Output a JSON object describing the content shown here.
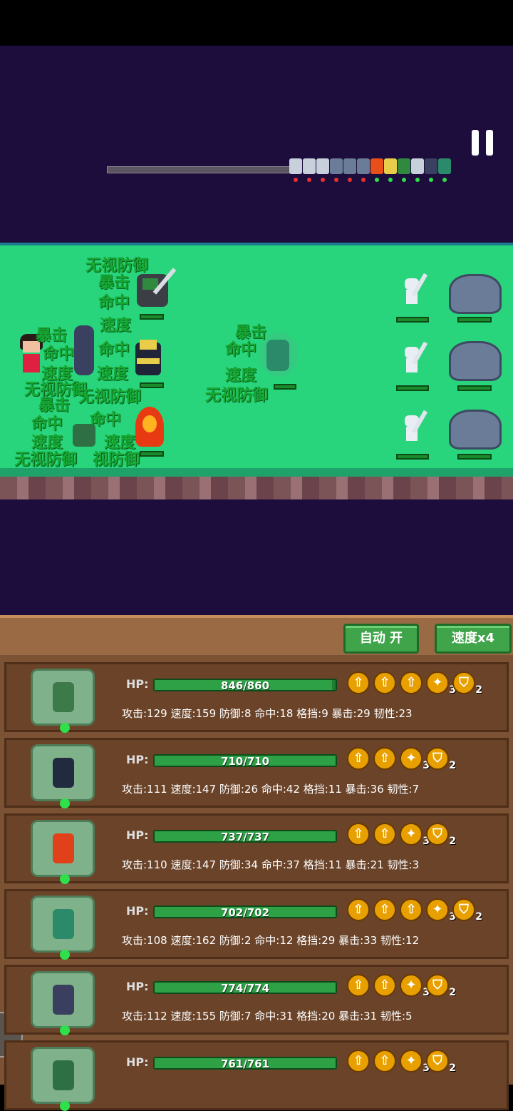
{
  "colors": {
    "sky": "#1c0d3c",
    "field": "#28d47c",
    "hp_green": "#1e7d33",
    "panel": "#7b5233",
    "buff_orange": "#e8a000",
    "damage_text": "#17a833"
  },
  "battle_queue": {
    "dots": [
      "red",
      "red",
      "red",
      "red",
      "red",
      "red",
      "green",
      "green",
      "green",
      "green",
      "green",
      "green"
    ]
  },
  "battlefield": {
    "floating_texts": [
      {
        "id": "t1",
        "text": "无视防御"
      },
      {
        "id": "t2",
        "text": "暴击"
      },
      {
        "id": "t3",
        "text": "命中"
      },
      {
        "id": "t4",
        "text": "速度"
      },
      {
        "id": "t5",
        "text": "暴击"
      },
      {
        "id": "t6",
        "text": "命中"
      },
      {
        "id": "t7",
        "text": "命中"
      },
      {
        "id": "t8",
        "text": "速度"
      },
      {
        "id": "t9",
        "text": "速度"
      },
      {
        "id": "t10",
        "text": "无视防御"
      },
      {
        "id": "t11",
        "text": "无视防御"
      },
      {
        "id": "t12",
        "text": "暴击"
      },
      {
        "id": "t13",
        "text": "命中"
      },
      {
        "id": "t14",
        "text": "命中"
      },
      {
        "id": "t15",
        "text": "速度"
      },
      {
        "id": "t16",
        "text": "速度"
      },
      {
        "id": "t17",
        "text": "无视防御"
      },
      {
        "id": "t18",
        "text": "视防御"
      },
      {
        "id": "t19",
        "text": "暴击"
      },
      {
        "id": "t20",
        "text": "命中"
      },
      {
        "id": "t21",
        "text": "速度"
      },
      {
        "id": "t22",
        "text": "无视防御"
      }
    ]
  },
  "panel_header": {
    "auto_button": "自动 开",
    "speed_button": "速度x4"
  },
  "heroes": [
    {
      "hp": "846/860",
      "hp_fraction": 0.98,
      "stats": "攻击:129 速度:159 防御:8 命中:18 格挡:9 暴击:29 韧性:23",
      "buffs": [
        "up",
        "up",
        "up",
        "crit3",
        "shield2"
      ],
      "portrait_color": "#3c7a4a"
    },
    {
      "hp": "710/710",
      "hp_fraction": 1.0,
      "stats": "攻击:111 速度:147 防御:26 命中:42 格挡:11 暴击:36 韧性:7",
      "buffs": [
        "up",
        "up",
        "crit3",
        "shield2"
      ],
      "portrait_color": "#222a40"
    },
    {
      "hp": "737/737",
      "hp_fraction": 1.0,
      "stats": "攻击:110 速度:147 防御:34 命中:37 格挡:11 暴击:21 韧性:3",
      "buffs": [
        "up",
        "up",
        "crit3",
        "shield2"
      ],
      "portrait_color": "#e0401a"
    },
    {
      "hp": "702/702",
      "hp_fraction": 1.0,
      "stats": "攻击:108 速度:162 防御:2 命中:12 格挡:29 暴击:33 韧性:12",
      "buffs": [
        "up",
        "up",
        "up",
        "crit3",
        "shield2"
      ],
      "portrait_color": "#2a8a6a"
    },
    {
      "hp": "774/774",
      "hp_fraction": 1.0,
      "stats": "攻击:112 速度:155 防御:7 命中:31 格挡:20 暴击:31 韧性:5",
      "buffs": [
        "up",
        "up",
        "crit3",
        "shield2"
      ],
      "portrait_color": "#3a3f60"
    },
    {
      "hp": "761/761",
      "hp_fraction": 1.0,
      "stats": "",
      "buffs": [
        "up",
        "up",
        "crit3",
        "shield2"
      ],
      "portrait_color": "#2f6f44"
    }
  ],
  "labels": {
    "hp": "HP:",
    "buff_up": "⇧",
    "buff_crit_count": "3",
    "buff_shield_count": "2"
  }
}
